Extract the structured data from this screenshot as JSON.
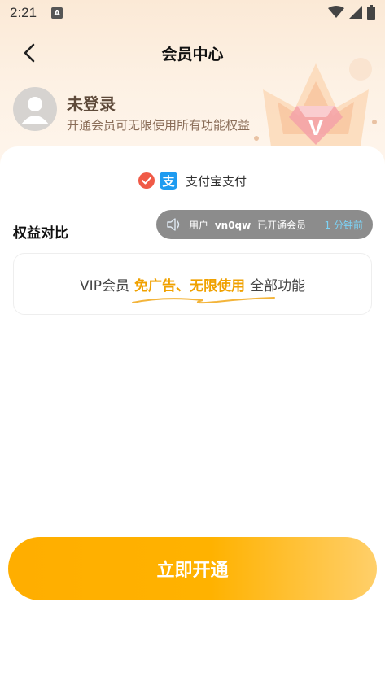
{
  "status_bar": {
    "time": "2:21",
    "notification_badge": "A",
    "icons": [
      "wifi-icon",
      "signal-icon",
      "battery-icon"
    ]
  },
  "header": {
    "title": "会员中心",
    "back_icon": "chevron-left-icon"
  },
  "user": {
    "name": "未登录",
    "subtitle": "开通会员可无限使用所有功能权益",
    "avatar_icon": "person-icon"
  },
  "payment": {
    "method_label": "支付宝支付",
    "method_icon_glyph": "支",
    "selected": true
  },
  "benefits": {
    "title": "权益对比",
    "vip_prefix": "VIP会员",
    "vip_highlight": "免广告、无限使用",
    "vip_suffix": "全部功能"
  },
  "notice": {
    "prefix": "用户",
    "user": "vn0qw",
    "action": "已开通会员",
    "time": "1 分钟前"
  },
  "cta": {
    "label": "立即开通"
  },
  "colors": {
    "accent": "#ffae00",
    "highlight_text": "#f0a100",
    "check": "#f05a47",
    "alipay": "#1e9bf0",
    "notice_bg": "#8c8c8c",
    "notice_time": "#7dd3f6"
  }
}
